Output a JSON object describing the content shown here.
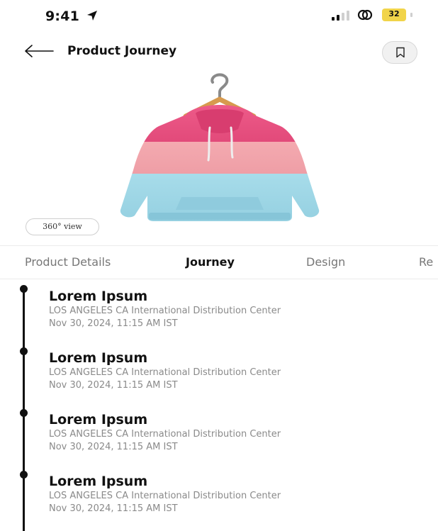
{
  "status_bar": {
    "time": "9:41",
    "battery_level": "32",
    "battery_color": "#f1d44a",
    "icons": [
      "location-arrow-icon",
      "signal-icon",
      "link-icon",
      "battery-icon"
    ]
  },
  "header": {
    "title": "Product Journey",
    "back_icon": "back-arrow-icon",
    "bookmark_icon": "bookmark-icon"
  },
  "product": {
    "view_label": "360° view",
    "image": "hoodie-on-hanger",
    "stripe_colors": [
      "#e8467c",
      "#f0a3a8",
      "#9fd6e6"
    ]
  },
  "tabs": [
    {
      "label": "Product Details",
      "active": false
    },
    {
      "label": "Journey",
      "active": true
    },
    {
      "label": "Design",
      "active": false
    },
    {
      "label": "Re",
      "active": false
    }
  ],
  "journey": {
    "events": [
      {
        "title": "Lorem Ipsum",
        "location": "LOS ANGELES CA International Distribution Center",
        "timestamp": "Nov 30, 2024, 11:15 AM IST"
      },
      {
        "title": "Lorem Ipsum",
        "location": "LOS ANGELES CA International Distribution Center",
        "timestamp": "Nov 30, 2024, 11:15 AM IST"
      },
      {
        "title": "Lorem Ipsum",
        "location": "LOS ANGELES CA International Distribution Center",
        "timestamp": "Nov 30, 2024, 11:15 AM IST"
      },
      {
        "title": "Lorem Ipsum",
        "location": "LOS ANGELES CA International Distribution Center",
        "timestamp": "Nov 30, 2024, 11:15 AM IST"
      }
    ]
  }
}
